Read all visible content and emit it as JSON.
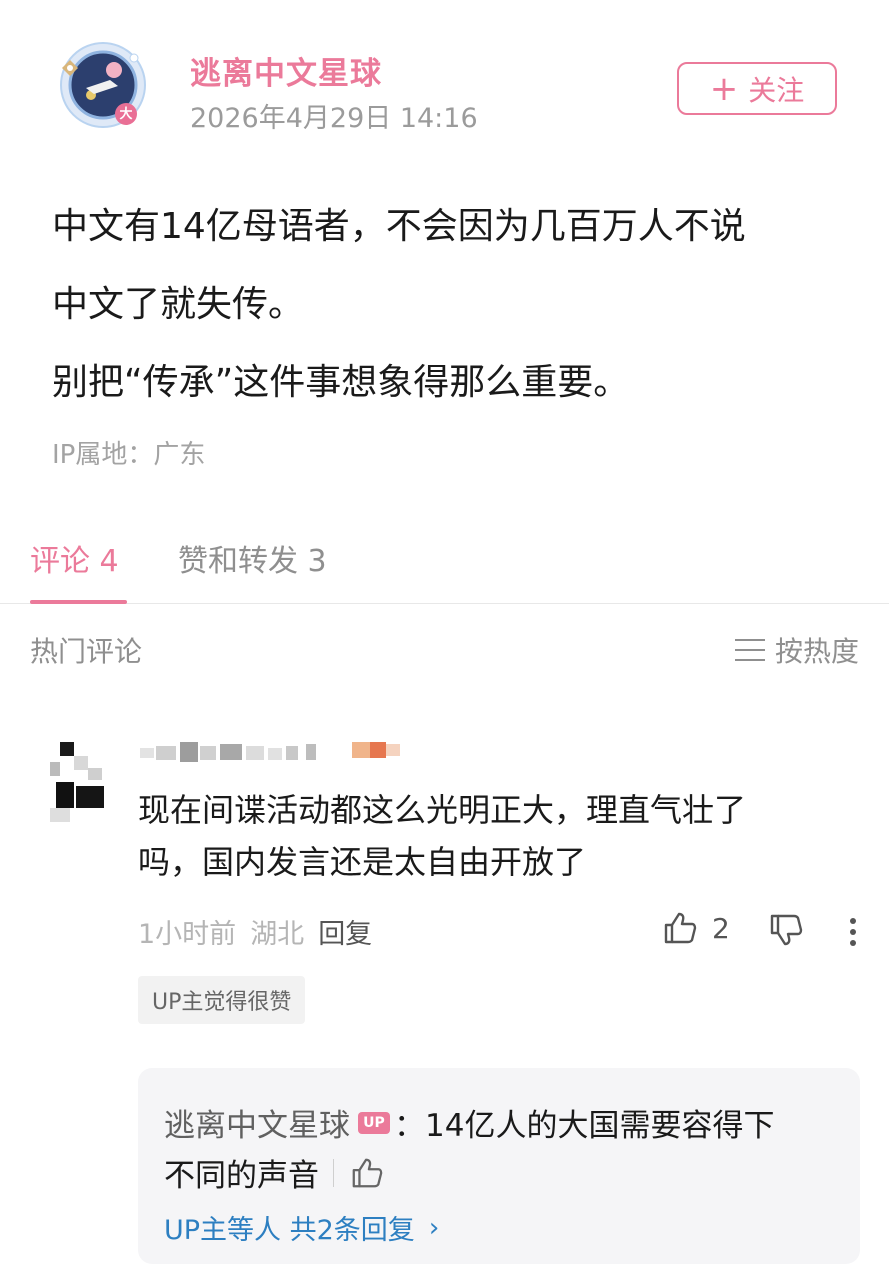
{
  "post": {
    "author": "逃离中文星球",
    "time": "2026年4月29日 14:16",
    "follow_label": "关注",
    "body_lines": [
      "中文有14亿母语者，不会因为几百万人不说",
      "中文了就失传。",
      "别把“传承”这件事想象得那么重要。"
    ],
    "ip_location": "IP属地：广东",
    "avatar_badge": "大"
  },
  "tabs": {
    "comments": "评论 4",
    "likes_reposts": "赞和转发 3"
  },
  "comments_header": {
    "label": "热门评论",
    "sort_label": "按热度"
  },
  "comment": {
    "text_lines": [
      "现在间谍活动都这么光明正大，理直气壮了",
      "吗，国内发言还是太自由开放了"
    ],
    "time": "1小时前",
    "location": "湖北",
    "reply_label": "回复",
    "like_count": "2",
    "up_liked_tag": "UP主觉得很赞",
    "reply": {
      "author": "逃离中文星球",
      "badge": "UP",
      "text_part1": "：14亿人的大国需要容得下",
      "text_part2": "不同的声音",
      "more_label": "UP主等人 共2条回复"
    }
  },
  "colors": {
    "accent_pink": "#eb7a9a",
    "link_blue": "#2d7fc1",
    "muted_gray": "#9b9b9b"
  },
  "icons": [
    "plus-icon",
    "menu-icon",
    "thumb-up-icon",
    "thumb-down-icon",
    "more-vertical-icon",
    "chevron-right-icon"
  ]
}
